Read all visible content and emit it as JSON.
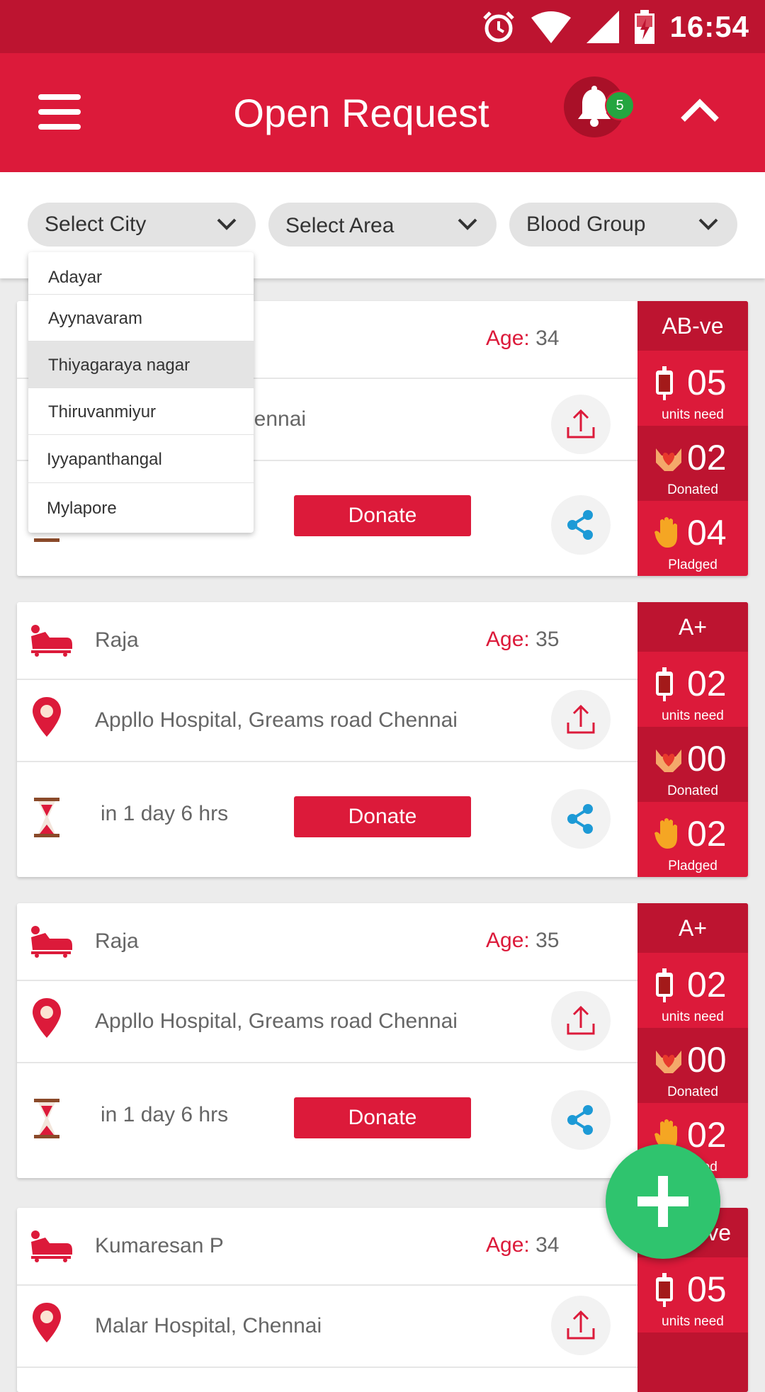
{
  "status_bar": {
    "time": "16:54"
  },
  "app_bar": {
    "title": "Open Request",
    "notification_count": "5"
  },
  "filters": {
    "city": "Select City",
    "area": "Select Area",
    "blood_group": "Blood Group"
  },
  "city_dropdown": {
    "options": [
      "Adayar",
      "Ayynavaram",
      "Thiyagaraya nagar",
      "Thiruvanmiyur",
      "Iyyapanthangal",
      "Mylapore"
    ],
    "highlighted": "Thiyagaraya nagar"
  },
  "labels": {
    "age": "Age:",
    "donate": "Donate",
    "units_need": "units need",
    "donated": "Donated",
    "pledged": "Pladged"
  },
  "requests": [
    {
      "name": "",
      "age": "34",
      "hospital": "hennai",
      "time_left": "",
      "blood_group": "AB-ve",
      "units_need": "05",
      "donated": "02",
      "pledged": "04"
    },
    {
      "name": "Raja",
      "age": "35",
      "hospital": "Appllo Hospital, Greams road Chennai",
      "time_left": "in 1 day 6 hrs",
      "blood_group": "A+",
      "units_need": "02",
      "donated": "00",
      "pledged": "02"
    },
    {
      "name": "Raja",
      "age": "35",
      "hospital": "Appllo Hospital, Greams road Chennai",
      "time_left": "in 1 day 6 hrs",
      "blood_group": "A+",
      "units_need": "02",
      "donated": "00",
      "pledged": "02"
    },
    {
      "name": "Kumaresan P",
      "age": "34",
      "hospital": "Malar Hospital, Chennai",
      "time_left": "",
      "blood_group": "ve",
      "units_need": "05",
      "donated": "",
      "pledged": ""
    }
  ],
  "colors": {
    "primary": "#dc1a3a",
    "primary_dark": "#bd1430",
    "fab": "#2fc46e",
    "share": "#1d9ad6"
  },
  "icons": [
    "menu-icon",
    "bell-icon",
    "chevron-up-icon",
    "chevron-down-icon",
    "patient-bed-icon",
    "location-pin-icon",
    "hourglass-icon",
    "upload-icon",
    "share-icon",
    "blood-bag-icon",
    "heart-hands-icon",
    "raised-hand-icon",
    "plus-icon",
    "alarm-icon",
    "wifi-icon",
    "signal-icon",
    "battery-icon"
  ]
}
